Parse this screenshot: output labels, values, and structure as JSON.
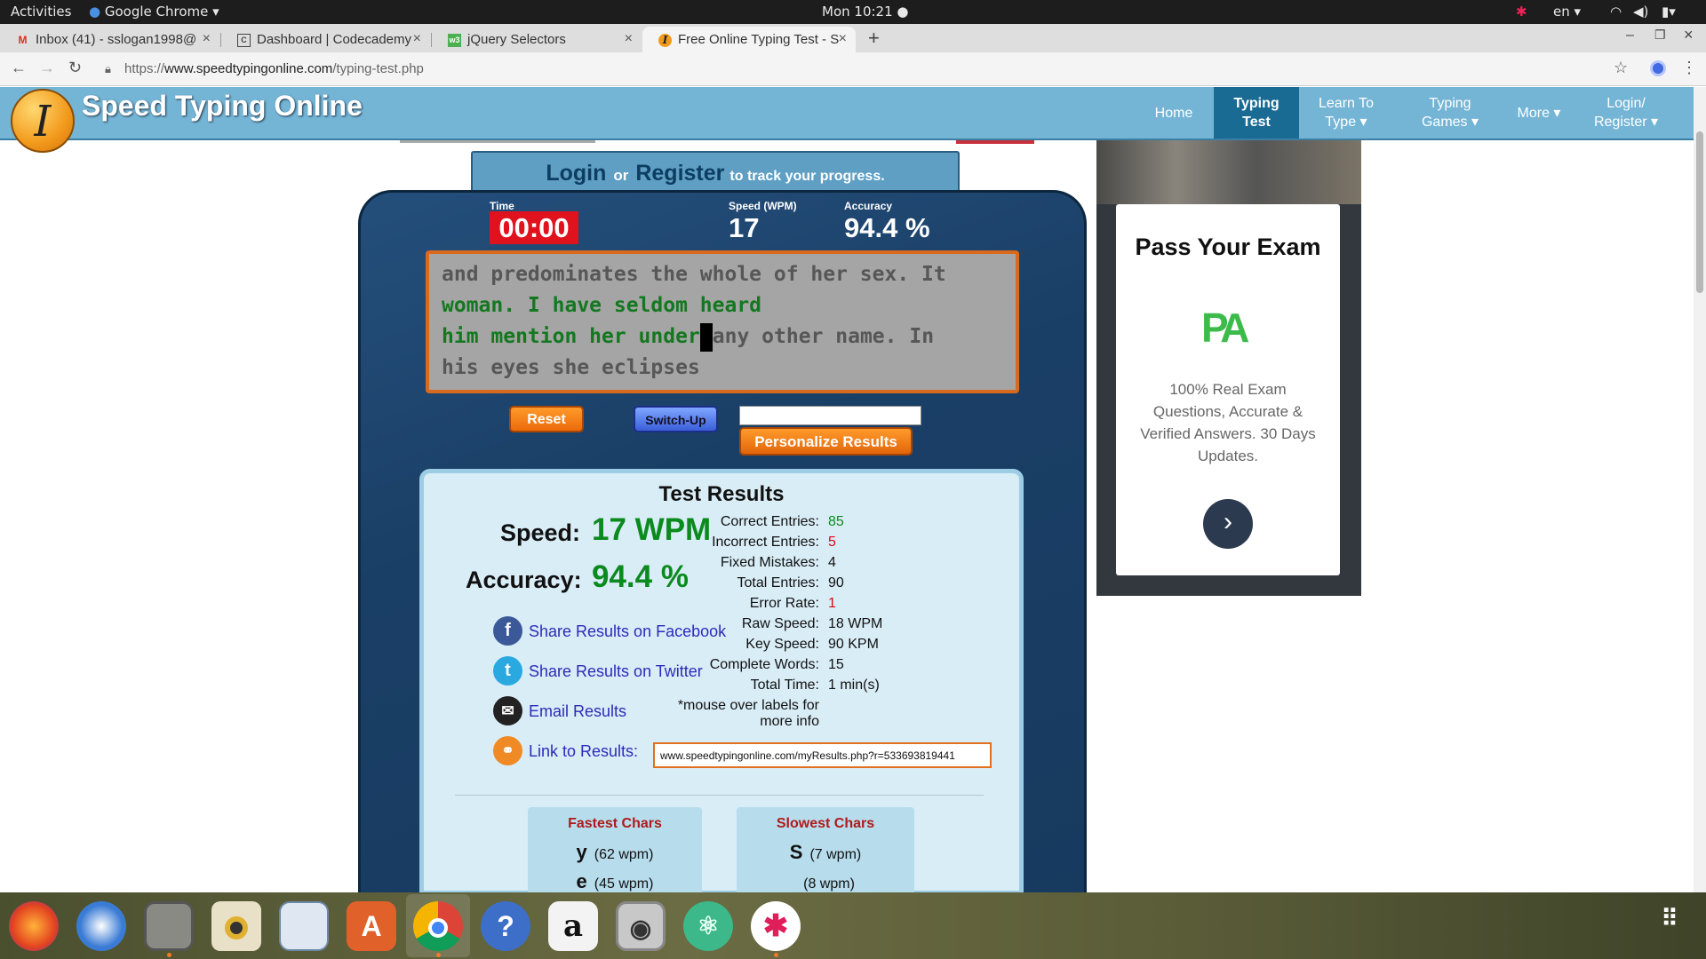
{
  "system_bar": {
    "activities": "Activities",
    "app": "Google Chrome ▾",
    "clock": "Mon 10:21 ●",
    "lang": "en ▾"
  },
  "tabs": [
    {
      "label": "Inbox (41) - sslogan1998@",
      "icon": "gmail-icon"
    },
    {
      "label": "Dashboard | Codecademy",
      "icon": "codecademy-icon"
    },
    {
      "label": "jQuery Selectors",
      "icon": "w3schools-icon"
    },
    {
      "label": "Free Online Typing Test - S",
      "icon": "speedtyping-icon",
      "active": true
    }
  ],
  "address": {
    "protocol": "https://",
    "host": "www.speedtypingonline.com",
    "path": "/typing-test.php"
  },
  "site": {
    "name": "Speed Typing Online",
    "logo_letter": "I",
    "nav": [
      {
        "label": "Home"
      },
      {
        "label": "Typing Test",
        "active": true
      },
      {
        "label": "Learn To Type ▾"
      },
      {
        "label": "Typing Games ▾"
      },
      {
        "label": "More ▾"
      },
      {
        "label": "Login/ Register ▾"
      }
    ]
  },
  "login_prompt": {
    "login": "Login",
    "or": "or",
    "register": "Register",
    "rest": "to track your progress."
  },
  "stats_header": {
    "time_label": "Time",
    "time_value": "00:00",
    "speed_label": "Speed (WPM)",
    "speed_value": "17",
    "accuracy_label": "Accuracy",
    "accuracy_value": "94.4 %"
  },
  "typing_text": {
    "line1": "and predominates the whole of her sex. It",
    "line2_typed": "woman. I have seldom heard",
    "line3_typed": "him mention her under",
    "line3_rest": "any other name. In",
    "line4": "his eyes she eclipses"
  },
  "controls": {
    "reset": "Reset",
    "switch_up": "Switch-Up",
    "personalize": "Personalize Results",
    "name_input": ""
  },
  "results": {
    "title": "Test Results",
    "speed_label": "Speed:",
    "speed_value": "17 WPM",
    "accuracy_label": "Accuracy:",
    "accuracy_value": "94.4 %",
    "share": [
      {
        "label": "Share Results on Facebook",
        "icon": "facebook-icon",
        "color": "#3b5998"
      },
      {
        "label": "Share Results on Twitter",
        "icon": "twitter-icon",
        "color": "#2aa9e0"
      },
      {
        "label": "Email Results",
        "icon": "email-icon",
        "color": "#222222"
      },
      {
        "label": "Link to Results:",
        "icon": "link-icon",
        "color": "#f08a24"
      }
    ],
    "link_value": "www.speedtypingonline.com/myResults.php?r=533693819441",
    "details": [
      {
        "label": "Correct Entries:",
        "value": "85",
        "color": "#0b8a1e"
      },
      {
        "label": "Incorrect Entries:",
        "value": "5",
        "color": "#d01010"
      },
      {
        "label": "Fixed Mistakes:",
        "value": "4",
        "color": "#111111"
      },
      {
        "label": "Total Entries:",
        "value": "90",
        "color": "#111111"
      },
      {
        "label": "Error Rate:",
        "value": "1",
        "color": "#d01010"
      },
      {
        "label": "Raw Speed:",
        "value": "18 WPM",
        "color": "#111111"
      },
      {
        "label": "Key Speed:",
        "value": "90 KPM",
        "color": "#111111"
      },
      {
        "label": "Complete Words:",
        "value": "15",
        "color": "#111111"
      },
      {
        "label": "Total Time:",
        "value": "1 min(s)",
        "color": "#111111"
      }
    ],
    "note_line1": "*mouse over labels for",
    "note_line2": "more info",
    "fastest": {
      "title": "Fastest Chars",
      "rows": [
        {
          "ch": "y",
          "wpm": "(62 wpm)"
        },
        {
          "ch": "e",
          "wpm": "(45 wpm)"
        }
      ]
    },
    "slowest": {
      "title": "Slowest Chars",
      "rows": [
        {
          "ch": "S",
          "wpm": "(7 wpm)"
        },
        {
          "ch": "",
          "wpm": "(8 wpm)"
        }
      ]
    }
  },
  "ad": {
    "title": "Pass Your Exam",
    "logo": "PA",
    "text": "100% Real Exam Questions, Accurate & Verified Answers. 30 Days Updates.",
    "button": "›"
  },
  "dock": [
    "firefox-icon",
    "thunderbird-icon",
    "files-icon",
    "rhythmbox-icon",
    "document-viewer-icon",
    "software-center-icon",
    "chrome-icon",
    "help-icon",
    "amazon-icon",
    "camera-icon",
    "atom-icon",
    "slack-icon"
  ]
}
